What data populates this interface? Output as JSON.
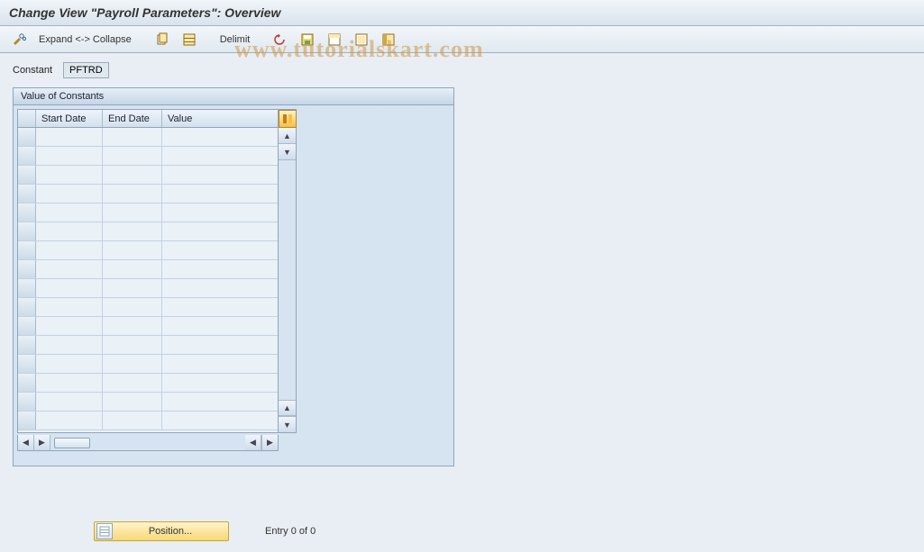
{
  "title": "Change View \"Payroll Parameters\": Overview",
  "watermark": "www.tutorialskart.com",
  "toolbar": {
    "expand": "Expand <-> Collapse",
    "delimit": "Delimit"
  },
  "field": {
    "label": "Constant",
    "value": "PFTRD"
  },
  "panel": {
    "title": "Value of Constants",
    "columns": {
      "start": "Start Date",
      "end": "End Date",
      "value": "Value"
    }
  },
  "footer": {
    "position": "Position...",
    "entry": "Entry 0 of 0"
  }
}
